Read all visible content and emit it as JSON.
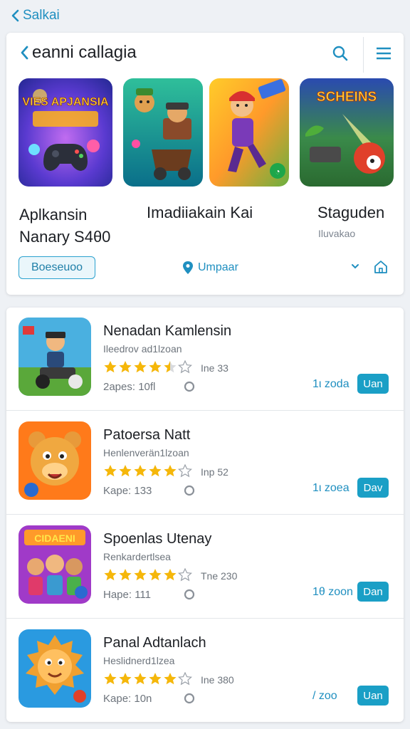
{
  "topbar": {
    "back_label": "Salkai"
  },
  "header": {
    "title": "eanni callagia"
  },
  "featured": {
    "tiles": [
      {
        "art_text": "VIES APJANSIA"
      },
      {
        "art_text": ""
      },
      {
        "art_text": ""
      },
      {
        "art_text": "SCHEINS"
      }
    ],
    "label_1_line1": "Aplkansin",
    "label_1_line2": "Nanary S4θ0",
    "label_2": "Imadiiakain Kai",
    "label_3": "Staguden",
    "label_3_sub": "Iluvakao"
  },
  "controls": {
    "pill_button": "Boeseuoo",
    "location_label": "Umpaar"
  },
  "apps": [
    {
      "title": "Nenadan Kamlensin",
      "subtitle": "Ileedrov ad1lzoan",
      "rating": 4.5,
      "count": "Ine 33",
      "meta": "2apes: 10fl",
      "time": "1ι zoda",
      "button": "Uan"
    },
    {
      "title": "Patoersa Natt",
      "subtitle": "Henlenverän1lzoan",
      "rating": 5,
      "count": "Inp 52",
      "meta": "Kape: 133",
      "time": "1ι zoea",
      "button": "Dav"
    },
    {
      "title": "Spoenlas Utenay",
      "subtitle": "Renkardertlsea",
      "rating": 5,
      "count": "Tne 230",
      "meta": "Hape: 111",
      "time": "1θ zoon",
      "button": "Dan"
    },
    {
      "title": "Panal Adtanlach",
      "subtitle": "Heslidnerd1lzea",
      "rating": 5,
      "count": "Ine 380",
      "meta": "Kape: 10n",
      "time": "/ zoo",
      "button": "Uan"
    }
  ],
  "colors": {
    "accent": "#1a9fc6",
    "star": "#f5b70a",
    "background": "#eef1f5"
  },
  "icons": [
    "chevron-left-icon",
    "search-icon",
    "menu-icon",
    "location-pin-icon",
    "chevron-down-icon",
    "home-icon",
    "star-icon"
  ]
}
